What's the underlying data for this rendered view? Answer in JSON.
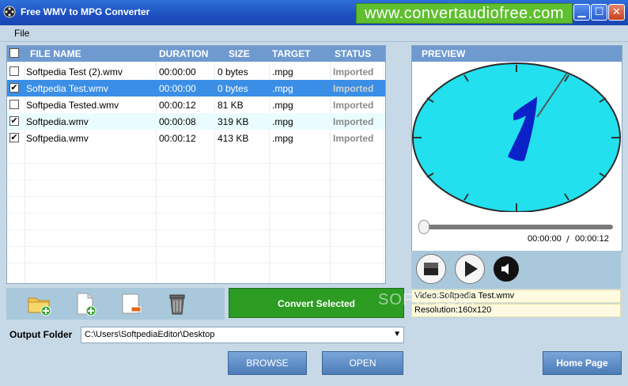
{
  "window": {
    "title": "Free WMV to MPG Converter",
    "banner": "www.convertaudiofree.com"
  },
  "menu": {
    "file": "File"
  },
  "table": {
    "headers": {
      "file_name": "FILE NAME",
      "duration": "DURATION",
      "size": "SIZE",
      "target": "TARGET",
      "status": "STATUS"
    },
    "rows": [
      {
        "checked": false,
        "name": "Softpedia Test (2).wmv",
        "duration": "00:00:00",
        "size": "0 bytes",
        "target": ".mpg",
        "status": "Imported"
      },
      {
        "checked": true,
        "name": "Softpedia Test.wmv",
        "duration": "00:00:00",
        "size": "0 bytes",
        "target": ".mpg",
        "status": "Imported"
      },
      {
        "checked": false,
        "name": "Softpedia Tested.wmv",
        "duration": "00:00:12",
        "size": "81 KB",
        "target": ".mpg",
        "status": "Imported"
      },
      {
        "checked": true,
        "name": "Softpedia.wmv",
        "duration": "00:00:08",
        "size": "319 KB",
        "target": ".mpg",
        "status": "Imported"
      },
      {
        "checked": true,
        "name": "Softpedia.wmv",
        "duration": "00:00:12",
        "size": "413 KB",
        "target": ".mpg",
        "status": "Imported"
      }
    ],
    "selected_row": 1
  },
  "toolbar": {
    "icons": [
      "add-folder-icon",
      "add-file-icon",
      "remove-file-icon",
      "trash-icon"
    ],
    "convert_label": "Convert Selected"
  },
  "output": {
    "label": "Output Folder",
    "path": "C:\\Users\\SoftpediaEditor\\Desktop"
  },
  "buttons": {
    "browse": "BROWSE",
    "open": "OPEN",
    "home": "Home Page"
  },
  "preview": {
    "title": "PREVIEW",
    "time_current": "00:00:00",
    "time_separator": "/",
    "time_total": "00:00:12",
    "seek_position": 0,
    "video_info": "Video:Softpedia Test.wmv",
    "resolution_info": "Resolution:160x120"
  },
  "watermark": "SOFTPEDIA",
  "colors": {
    "titlebar": "#1d4fbf",
    "banner": "#5fbf2f",
    "convert": "#2c9c23",
    "header": "#6f9ad0",
    "clock_face": "#22e0ee"
  }
}
